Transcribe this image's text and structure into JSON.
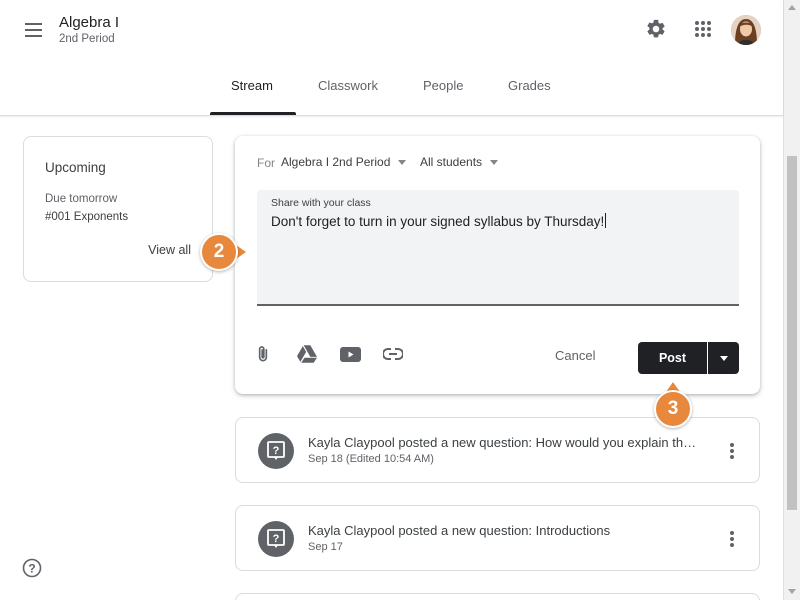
{
  "header": {
    "class_name": "Algebra I",
    "class_period": "2nd Period",
    "icons": {
      "menu": "menu-icon",
      "settings": "gear-icon",
      "apps": "apps-grid-icon",
      "account": "avatar"
    }
  },
  "tabs": [
    {
      "label": "Stream",
      "active": true
    },
    {
      "label": "Classwork",
      "active": false
    },
    {
      "label": "People",
      "active": false
    },
    {
      "label": "Grades",
      "active": false
    }
  ],
  "upcoming": {
    "title": "Upcoming",
    "due_label": "Due tomorrow",
    "item": "#001 Exponents",
    "view_all": "View all"
  },
  "compose": {
    "for_label": "For",
    "class_select": "Algebra I 2nd Period",
    "audience_select": "All students",
    "field_label": "Share with your class",
    "field_value": "Don't forget to turn in your signed syllabus by Thursday!",
    "tool_icons": [
      "attach-icon",
      "drive-icon",
      "youtube-icon",
      "link-icon"
    ],
    "cancel_label": "Cancel",
    "post_label": "Post"
  },
  "stream": [
    {
      "title": "Kayla Claypool posted a new question: How would you explain the law of exponents?",
      "date": "Sep 18 (Edited 10:54 AM)",
      "icon": "question-icon"
    },
    {
      "title": "Kayla Claypool posted a new question: Introductions",
      "date": "Sep 17",
      "icon": "question-icon"
    }
  ],
  "callouts": {
    "step2": "2",
    "step3": "3"
  },
  "colors": {
    "callout": "#e8883c",
    "post_button": "#202124",
    "icon_gray": "#5f6368"
  }
}
